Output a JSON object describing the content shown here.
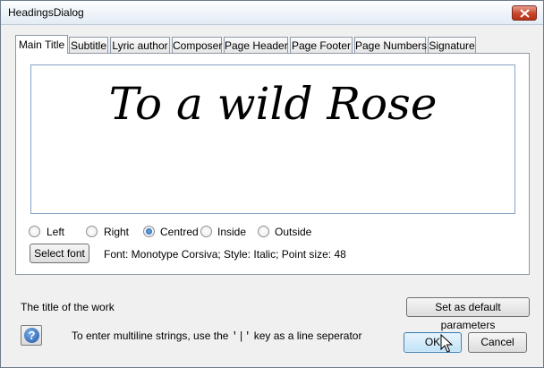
{
  "window": {
    "title": "HeadingsDialog"
  },
  "tabs": [
    "Main Title",
    "Subtitle",
    "Lyric author",
    "Composer",
    "Page Header",
    "Page Footer",
    "Page Numbers",
    "Signature"
  ],
  "active_tab": "Main Title",
  "preview": {
    "text": "To a wild Rose"
  },
  "alignment": {
    "options": [
      "Left",
      "Right",
      "Centred",
      "Inside",
      "Outside"
    ],
    "selected": "Centred"
  },
  "font": {
    "button_label": "Select font",
    "info": "Font: Monotype Corsiva; Style: Italic; Point size: 48"
  },
  "footer": {
    "description": "The title of the work",
    "default_button": "Set as default parameters",
    "hint_prefix": "To enter multiline strings, use the",
    "hint_key": "'|'",
    "hint_suffix": "key as a line seperator",
    "help_symbol": "?",
    "ok": "OK",
    "cancel": "Cancel"
  },
  "colors": {
    "close_button": "#c7452a",
    "default_button_border": "#3c7fb1",
    "help_icon": "#1f55a3"
  },
  "icons": {
    "close": "close-icon",
    "help": "help-icon",
    "cursor": "mouse-pointer-icon"
  }
}
